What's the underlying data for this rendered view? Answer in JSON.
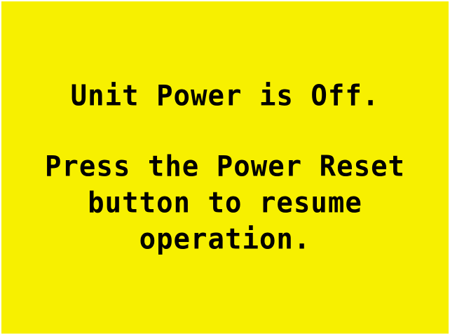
{
  "screen": {
    "background_color": "#f7f000",
    "text_color": "#000000",
    "status_message": "Unit Power is Off.",
    "instruction_lines": [
      "Press the Power Reset",
      "button to resume",
      "operation."
    ]
  }
}
